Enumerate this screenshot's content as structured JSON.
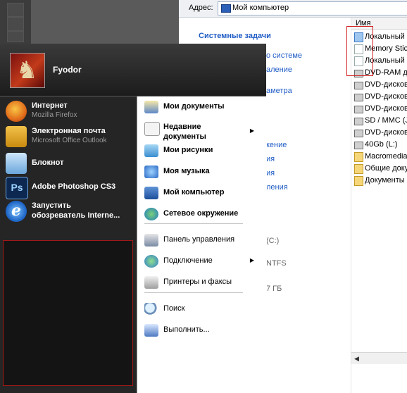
{
  "explorer": {
    "address_label": "Адрес:",
    "address_value": "Мой компьютер",
    "tasks_title": "Системные задачи",
    "bg_links": [
      "о системе",
      "аление",
      "аметра",
      "кение",
      "ия",
      "ия",
      "ления"
    ],
    "bg_details": [
      "(C:)",
      "NTFS",
      "7 ГБ"
    ],
    "column_name": "Имя",
    "files": [
      {
        "name": "Локальный",
        "icon": "blue-file-icon"
      },
      {
        "name": "Memory Stic",
        "icon": "document-icon"
      },
      {
        "name": "Локальный",
        "icon": "document-icon"
      },
      {
        "name": "DVD-RAM д",
        "icon": "drive-icon"
      },
      {
        "name": "DVD-дисков",
        "icon": "drive-icon"
      },
      {
        "name": "DVD-дисков",
        "icon": "drive-icon"
      },
      {
        "name": "DVD-дисков",
        "icon": "drive-icon"
      },
      {
        "name": "SD / MMC (J",
        "icon": "drive-icon"
      },
      {
        "name": "DVD-дисков",
        "icon": "drive-icon"
      },
      {
        "name": "40Gb (L:)",
        "icon": "drive-icon"
      },
      {
        "name": "Macromedia",
        "icon": "folder-icon"
      },
      {
        "name": "Общие доку",
        "icon": "folder-icon"
      },
      {
        "name": "Документы",
        "icon": "folder-icon"
      }
    ]
  },
  "start_menu": {
    "user_name": "Fyodor",
    "pinned": [
      {
        "title": "Интернет",
        "subtitle": "Mozilla Firefox",
        "icon": "firefox-icon"
      },
      {
        "title": "Электронная почта",
        "subtitle": "Microsoft Office Outlook",
        "icon": "outlook-icon"
      },
      {
        "title": "Блокнот",
        "subtitle": "",
        "icon": "notepad-icon"
      },
      {
        "title": "Adobe Photoshop CS3",
        "subtitle": "",
        "icon": "photoshop-icon",
        "icon_text": "Ps"
      },
      {
        "title": "Запустить",
        "title2": "обозреватель Interne...",
        "icon": "internet-explorer-icon",
        "icon_text": "e"
      }
    ],
    "places": [
      {
        "label": "Мои документы",
        "icon": "my-documents-icon",
        "bold": true
      },
      {
        "label": "Недавние",
        "label2": "документы",
        "icon": "recent-documents-icon",
        "bold": true,
        "submenu": true
      },
      {
        "label": "Мои рисунки",
        "icon": "my-pictures-icon",
        "bold": true
      },
      {
        "label": "Моя музыка",
        "icon": "my-music-icon",
        "bold": true
      },
      {
        "label": "Мой компьютер",
        "icon": "my-computer-icon",
        "bold": true
      },
      {
        "label": "Сетевое окружение",
        "icon": "network-icon",
        "bold": true
      },
      {
        "label": "Панель управления",
        "icon": "control-panel-icon",
        "bold": false
      },
      {
        "label": "Подключение",
        "icon": "connect-icon",
        "bold": false,
        "submenu": true
      },
      {
        "label": "Принтеры и факсы",
        "icon": "printers-icon",
        "bold": false
      },
      {
        "label": "Поиск",
        "icon": "search-icon",
        "bold": false
      },
      {
        "label": "Выполнить...",
        "icon": "run-icon",
        "bold": false
      }
    ],
    "submenu_arrow": "▶"
  },
  "colors": {
    "link_blue": "#215dc6",
    "menu_dark": "#252525",
    "highlight_red": "#d42222"
  }
}
